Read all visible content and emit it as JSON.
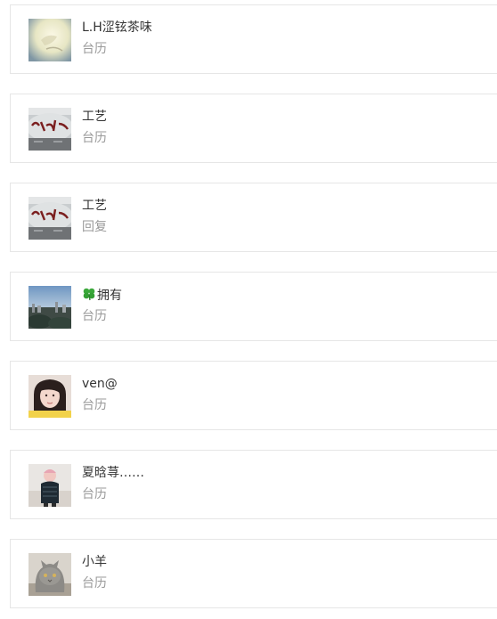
{
  "items": [
    {
      "name": "L.H涩铉茶味",
      "subtitle": "台历",
      "avatar": "avatar-pale-sketch"
    },
    {
      "name": "工艺",
      "subtitle": "台历",
      "avatar": "avatar-stone-calligraphy"
    },
    {
      "name": "工艺",
      "subtitle": "回复",
      "avatar": "avatar-stone-calligraphy"
    },
    {
      "name": "拥有",
      "subtitle": "台历",
      "avatar": "avatar-city-landscape",
      "prefix_icon": "clover-icon"
    },
    {
      "name": "ven@",
      "subtitle": "台历",
      "avatar": "avatar-girl-portrait"
    },
    {
      "name": "夏晗荨……",
      "subtitle": "台历",
      "avatar": "avatar-child-photo"
    },
    {
      "name": "小羊",
      "subtitle": "台历",
      "avatar": "avatar-cat-photo"
    }
  ]
}
